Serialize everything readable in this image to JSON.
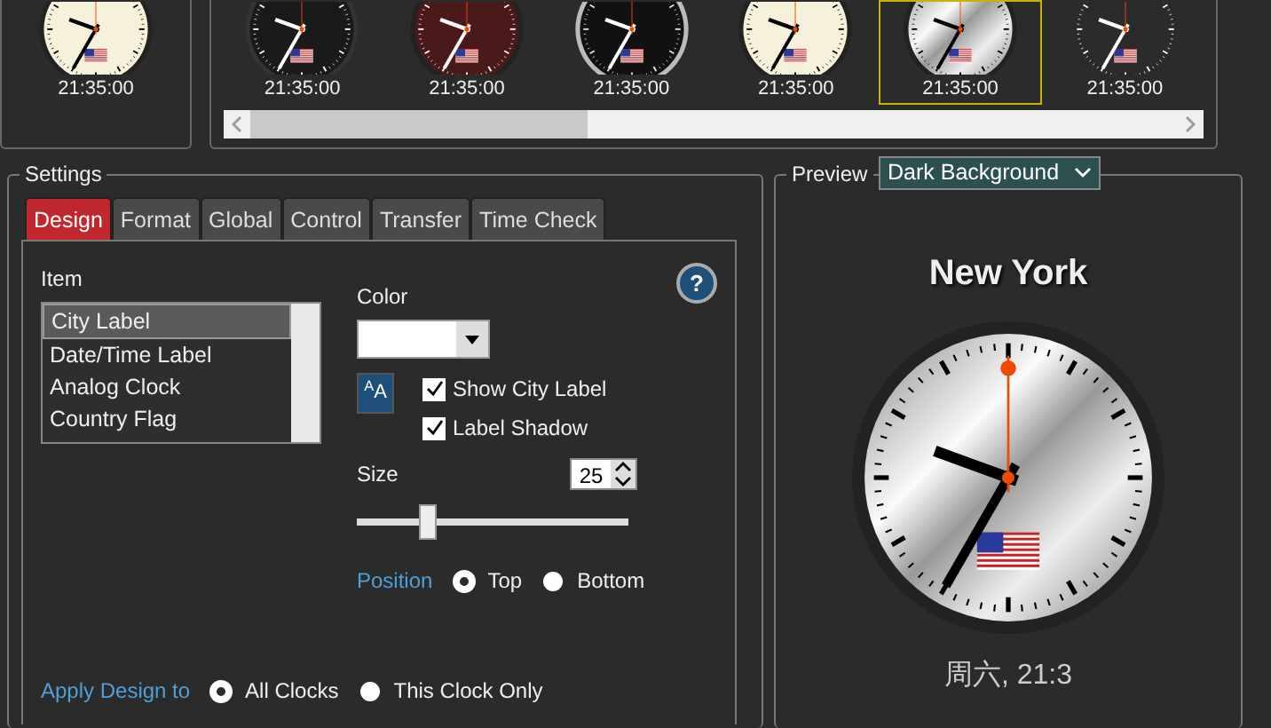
{
  "left_clock": {
    "kind": "cream",
    "time": "21:35:00"
  },
  "gallery": {
    "clocks": [
      {
        "kind": "black",
        "time": "21:35:00",
        "selected": false
      },
      {
        "kind": "darkred",
        "time": "21:35:00",
        "selected": false
      },
      {
        "kind": "ringed",
        "time": "21:35:00",
        "selected": false
      },
      {
        "kind": "cream",
        "time": "21:35:00",
        "selected": false
      },
      {
        "kind": "silver",
        "time": "21:35:00",
        "selected": true
      },
      {
        "kind": "minimal",
        "time": "21:35:00",
        "selected": false
      }
    ]
  },
  "settings": {
    "title": "Settings",
    "tabs": [
      {
        "label": "Design",
        "selected": true
      },
      {
        "label": "Format",
        "selected": false
      },
      {
        "label": "Global",
        "selected": false
      },
      {
        "label": "Control",
        "selected": false
      },
      {
        "label": "Transfer",
        "selected": false
      },
      {
        "label": "Time Check",
        "selected": false
      }
    ],
    "item_label": "Item",
    "items": [
      {
        "label": "City Label",
        "selected": true
      },
      {
        "label": "Date/Time Label",
        "selected": false
      },
      {
        "label": "Analog Clock",
        "selected": false
      },
      {
        "label": "Country Flag",
        "selected": false
      }
    ],
    "help": "?",
    "color_label": "Color",
    "font_button": "$^{A}$A",
    "checkboxes": [
      {
        "label": "Show City Label",
        "checked": true
      },
      {
        "label": "Label Shadow",
        "checked": true
      }
    ],
    "size": {
      "label": "Size",
      "value": "25",
      "level": 0.26
    },
    "position": {
      "label": "Position",
      "options": [
        {
          "label": "Top",
          "selected": true
        },
        {
          "label": "Bottom",
          "selected": false
        }
      ]
    },
    "apply": {
      "label": "Apply Design to",
      "options": [
        {
          "label": "All Clocks",
          "selected": true
        },
        {
          "label": "This Clock Only",
          "selected": false
        }
      ]
    }
  },
  "preview": {
    "title": "Preview",
    "background": "Dark Background",
    "city": "New York",
    "date": "周六, 21:3"
  }
}
